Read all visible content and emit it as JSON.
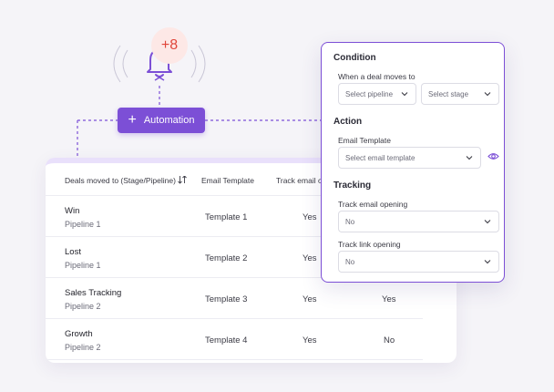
{
  "notification": {
    "badge": "+8"
  },
  "automation_button": {
    "label": "Automation"
  },
  "table": {
    "headers": [
      "Deals moved to (Stage/Pipeline)",
      "Email Template",
      "Track email op"
    ],
    "rows": [
      {
        "deal": "Win",
        "pipeline": "Pipeline 1",
        "template": "Template 1",
        "track_email": "Yes",
        "track_link": ""
      },
      {
        "deal": "Lost",
        "pipeline": "Pipeline 1",
        "template": "Template 2",
        "track_email": "Yes",
        "track_link": ""
      },
      {
        "deal": "Sales Tracking",
        "pipeline": "Pipeline 2",
        "template": "Template 3",
        "track_email": "Yes",
        "track_link": "Yes"
      },
      {
        "deal": "Growth",
        "pipeline": "Pipeline 2",
        "template": "Template 4",
        "track_email": "Yes",
        "track_link": "No"
      }
    ]
  },
  "panel": {
    "condition": {
      "title": "Condition",
      "label": "When a deal moves to",
      "pipeline_placeholder": "Select pipeline",
      "stage_placeholder": "Select stage"
    },
    "action": {
      "title": "Action",
      "label": "Email Template",
      "template_placeholder": "Select email template"
    },
    "tracking": {
      "title": "Tracking",
      "email_label": "Track email opening",
      "email_value": "No",
      "link_label": "Track link opening",
      "link_value": "No"
    }
  },
  "colors": {
    "accent": "#7c4fd6",
    "badge_bg": "#fde8e6",
    "badge_text": "#e0453a"
  }
}
